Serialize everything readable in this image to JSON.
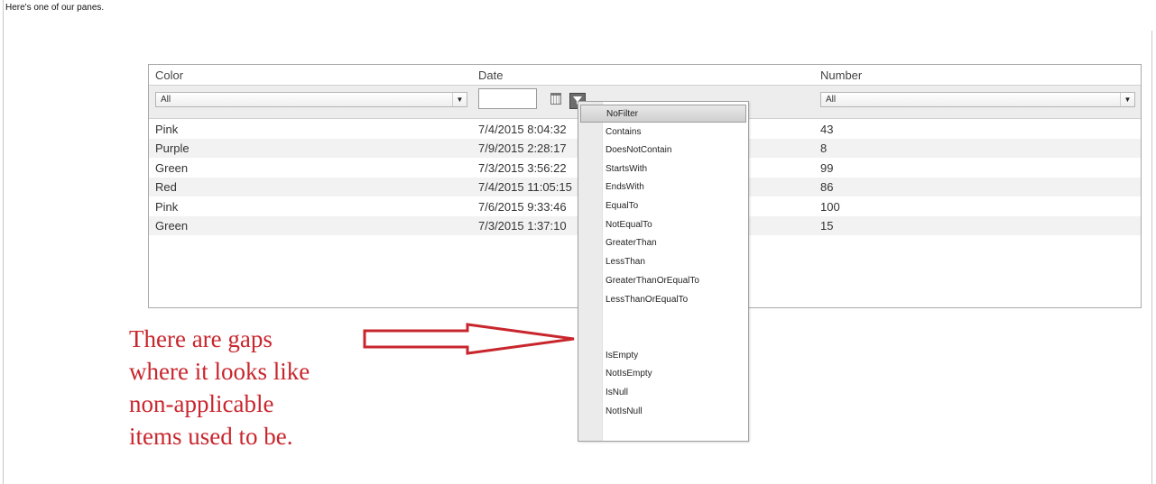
{
  "intro_text": "Here's one of our panes.",
  "grid": {
    "columns": [
      "Color",
      "Date",
      "Number"
    ],
    "filters": {
      "color": "All",
      "number": "All"
    },
    "rows": [
      {
        "color": "Pink",
        "date": "7/4/2015 8:04:32",
        "number": "43"
      },
      {
        "color": "Purple",
        "date": "7/9/2015 2:28:17",
        "number": "8"
      },
      {
        "color": "Green",
        "date": "7/3/2015 3:56:22",
        "number": "99"
      },
      {
        "color": "Red",
        "date": "7/4/2015 11:05:15",
        "number": "86"
      },
      {
        "color": "Pink",
        "date": "7/6/2015 9:33:46",
        "number": "100"
      },
      {
        "color": "Green",
        "date": "7/3/2015 1:37:10",
        "number": "15"
      }
    ]
  },
  "filter_menu": {
    "options": [
      "NoFilter",
      "Contains",
      "DoesNotContain",
      "StartsWith",
      "EndsWith",
      "EqualTo",
      "NotEqualTo",
      "GreaterThan",
      "LessThan",
      "GreaterThanOrEqualTo",
      "LessThanOrEqualTo",
      "IsEmpty",
      "NotIsEmpty",
      "IsNull",
      "NotIsNull"
    ],
    "selected": "NoFilter"
  },
  "annotation": {
    "lines": [
      "There are gaps",
      "where it looks like",
      "non-applicable",
      "items used to be."
    ],
    "color": "#c8262d"
  }
}
